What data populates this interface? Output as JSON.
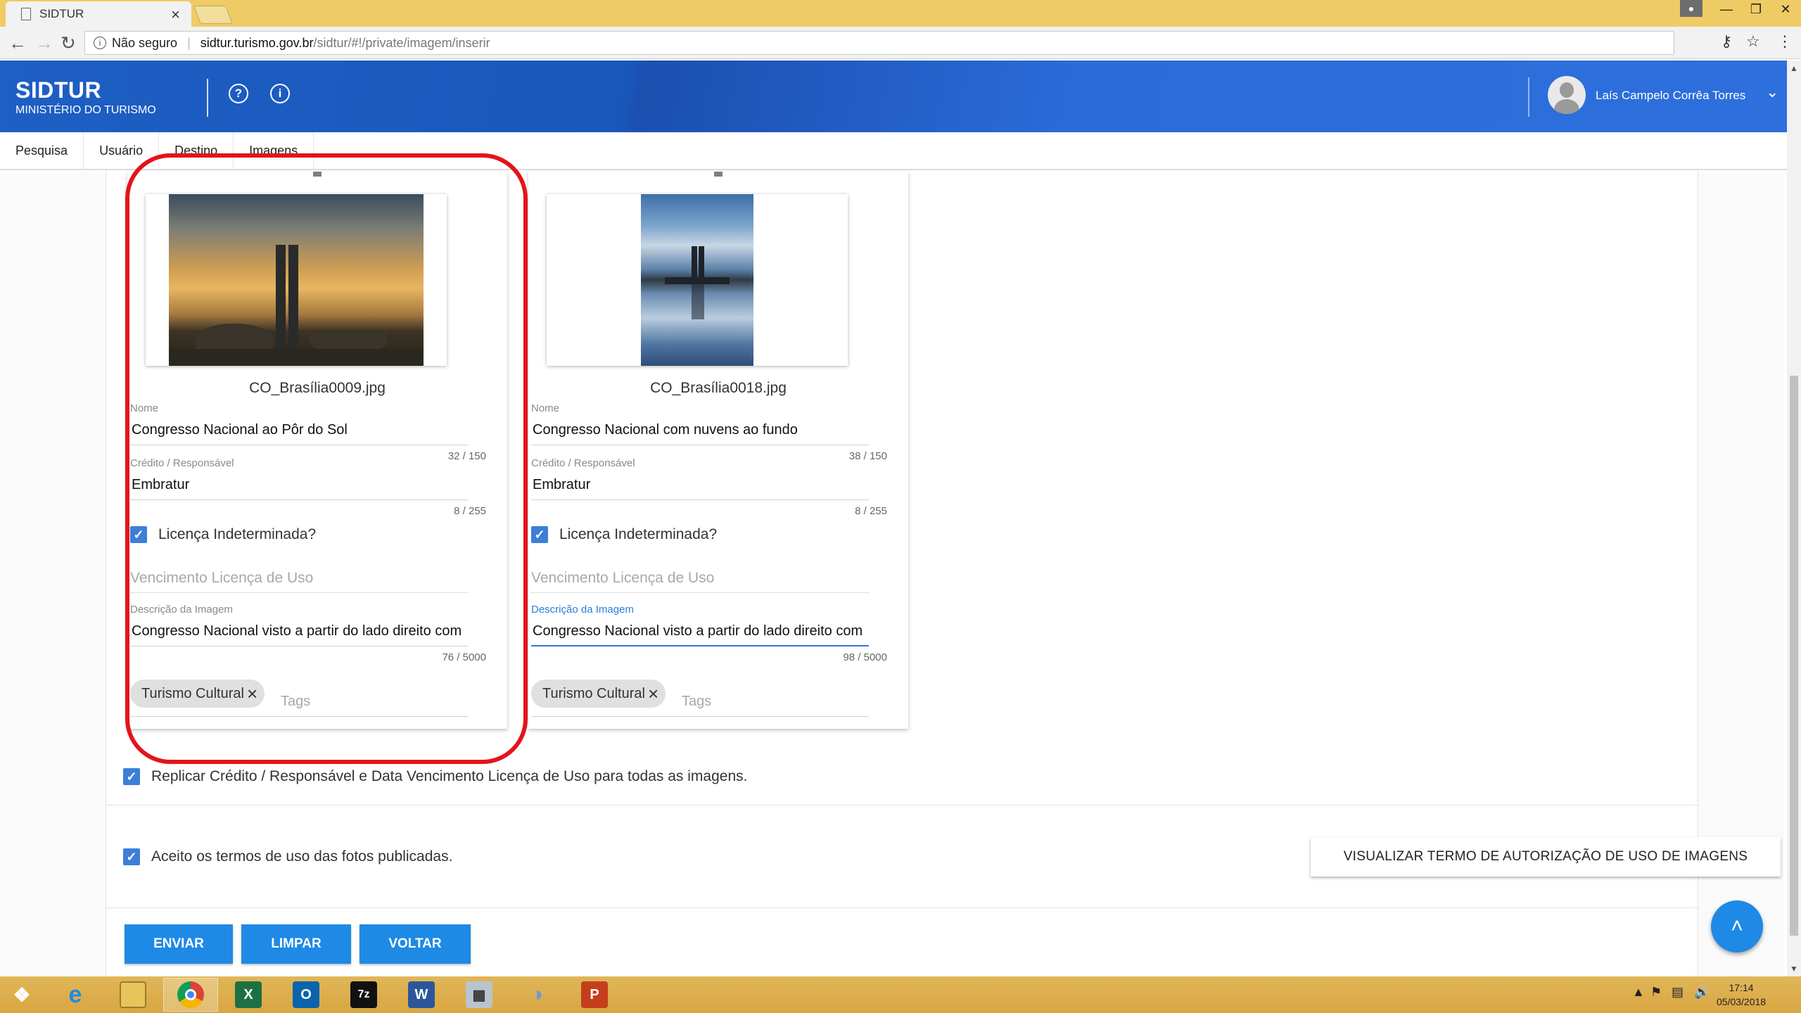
{
  "browser": {
    "tab_title": "SIDTUR",
    "tab_close": "×",
    "security": "Não seguro",
    "url_host": "sidtur.turismo.gov.br",
    "url_path": "/sidtur/#!/private/imagem/inserir"
  },
  "header": {
    "brand": "SIDTUR",
    "subtitle": "MINISTÉRIO DO TURISMO",
    "help_icon": "?",
    "info_icon": "i",
    "user_name": "Laís Campelo Corrêa Torres",
    "user_chevron": "⌄"
  },
  "nav": {
    "tabs": [
      "Pesquisa",
      "Usuário",
      "Destino",
      "Imagens"
    ]
  },
  "cards": [
    {
      "filename": "CO_Brasília0009.jpg",
      "nome_label": "Nome",
      "nome_value": "Congresso Nacional ao Pôr do Sol",
      "nome_counter": "32 / 150",
      "credito_label": "Crédito / Responsável",
      "credito_value": "Embratur",
      "credito_counter": "8 / 255",
      "licenca_label": "Licença Indeterminada?",
      "vencimento_placeholder": "Vencimento Licença de Uso",
      "descricao_label": "Descrição da Imagem",
      "descricao_value": "Congresso Nacional visto a partir do lado direito com",
      "descricao_counter": "76 / 5000",
      "tag": "Turismo Cultural",
      "tags_placeholder": "Tags"
    },
    {
      "filename": "CO_Brasília0018.jpg",
      "nome_label": "Nome",
      "nome_value": "Congresso Nacional com nuvens ao fundo",
      "nome_counter": "38 / 150",
      "credito_label": "Crédito / Responsável",
      "credito_value": "Embratur",
      "credito_counter": "8 / 255",
      "licenca_label": "Licença Indeterminada?",
      "vencimento_placeholder": "Vencimento Licença de Uso",
      "descricao_label": "Descrição da Imagem",
      "descricao_value": "Congresso Nacional visto a partir do lado direito com",
      "descricao_counter": "98 / 5000",
      "tag": "Turismo Cultural",
      "tags_placeholder": "Tags"
    }
  ],
  "form": {
    "replicar_label": "Replicar Crédito / Responsável e Data Vencimento Licença de Uso para todas as imagens.",
    "aceito_label": "Aceito os termos de uso das fotos publicadas.",
    "termo_button": "VISUALIZAR TERMO DE AUTORIZAÇÃO DE USO DE IMAGENS",
    "enviar": "ENVIAR",
    "limpar": "LIMPAR",
    "voltar": "VOLTAR",
    "fab_icon": "˄"
  },
  "taskbar": {
    "time": "17:14",
    "date": "05/03/2018"
  },
  "colors": {
    "accent": "#1e8ae6",
    "header": "#1e5fc4",
    "highlight": "#e3141b",
    "taskbar": "#d9a642"
  }
}
